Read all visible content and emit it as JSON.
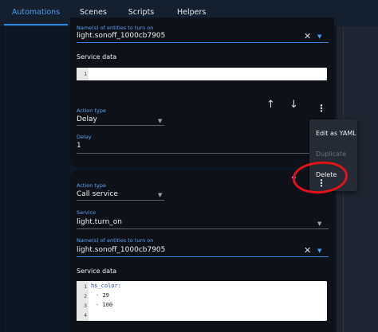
{
  "tabs": [
    {
      "label": "Automations",
      "active": true
    },
    {
      "label": "Scenes",
      "active": false
    },
    {
      "label": "Scripts",
      "active": false
    },
    {
      "label": "Helpers",
      "active": false
    }
  ],
  "card1": {
    "entities_label": "Name(s) of entities to turn on",
    "entities_value": "light.sonoff_1000cb7905",
    "service_data_label": "Service data",
    "editor_lines": [
      "1"
    ]
  },
  "card2": {
    "action_type_label": "Action type",
    "action_type_value": "Delay",
    "delay_label": "Delay",
    "delay_value": "1"
  },
  "card3": {
    "action_type_label": "Action type",
    "action_type_value": "Call service",
    "service_label": "Service",
    "service_value": "light.turn_on",
    "entities_label": "Name(s) of entities to turn on",
    "entities_value": "light.sonoff_1000cb7905",
    "service_data_label": "Service data",
    "editor_line_numbers": [
      "1",
      "2",
      "3",
      "4"
    ],
    "code": {
      "line1_key": "hs_color:",
      "line2_dash": "- ",
      "line2_value": "29",
      "line3_dash": "- ",
      "line3_value": "100"
    }
  },
  "menu": {
    "items": [
      {
        "label": "Edit as YAML",
        "disabled": false
      },
      {
        "label": "Duplicate",
        "disabled": true
      },
      {
        "label": "Delete",
        "disabled": false
      }
    ]
  },
  "icons": {
    "clear": "clear-icon",
    "dropdown": "chevron-down-icon",
    "move_up": "arrow-up-icon",
    "move_down": "arrow-down-icon",
    "overflow": "overflow-menu-icon"
  },
  "colors": {
    "accent": "#2f8be8",
    "background": "#0e1724",
    "card": "#0f1118",
    "annotation": "#e0121c"
  }
}
